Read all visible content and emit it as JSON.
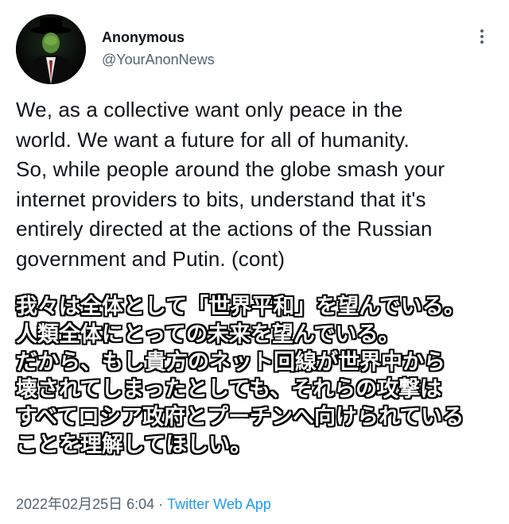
{
  "author": {
    "display_name": "Anonymous",
    "handle": "@YourAnonNews"
  },
  "tweet": {
    "text": "We, as a collective want only peace in the\nworld.  We want a future for all of humanity.\nSo, while people around the globe smash your\ninternet providers to bits, understand that it's\nentirely directed at the actions of the Russian\ngovernment and Putin. (cont)",
    "image_caption_lines": [
      "我々は全体として「世界平和」を望んでいる。",
      "人類全体にとっての未来を望んでいる。",
      "だから、もし貴方のネット回線が世界中から",
      "壊されてしまったとしても、それらの攻撃は",
      "すべてロシア政府とプーチンへ向けられている",
      "ことを理解してほしい。"
    ]
  },
  "meta": {
    "timestamp": "2022年02月25日 6:04",
    "separator": "·",
    "source": "Twitter Web App"
  },
  "icons": {
    "avatar": "anonymous-mask-avatar",
    "more": "more-vertical-icon"
  },
  "colors": {
    "text_primary": "#0f1419",
    "text_secondary": "#536471",
    "link": "#1d9bf0",
    "background": "#ffffff"
  }
}
